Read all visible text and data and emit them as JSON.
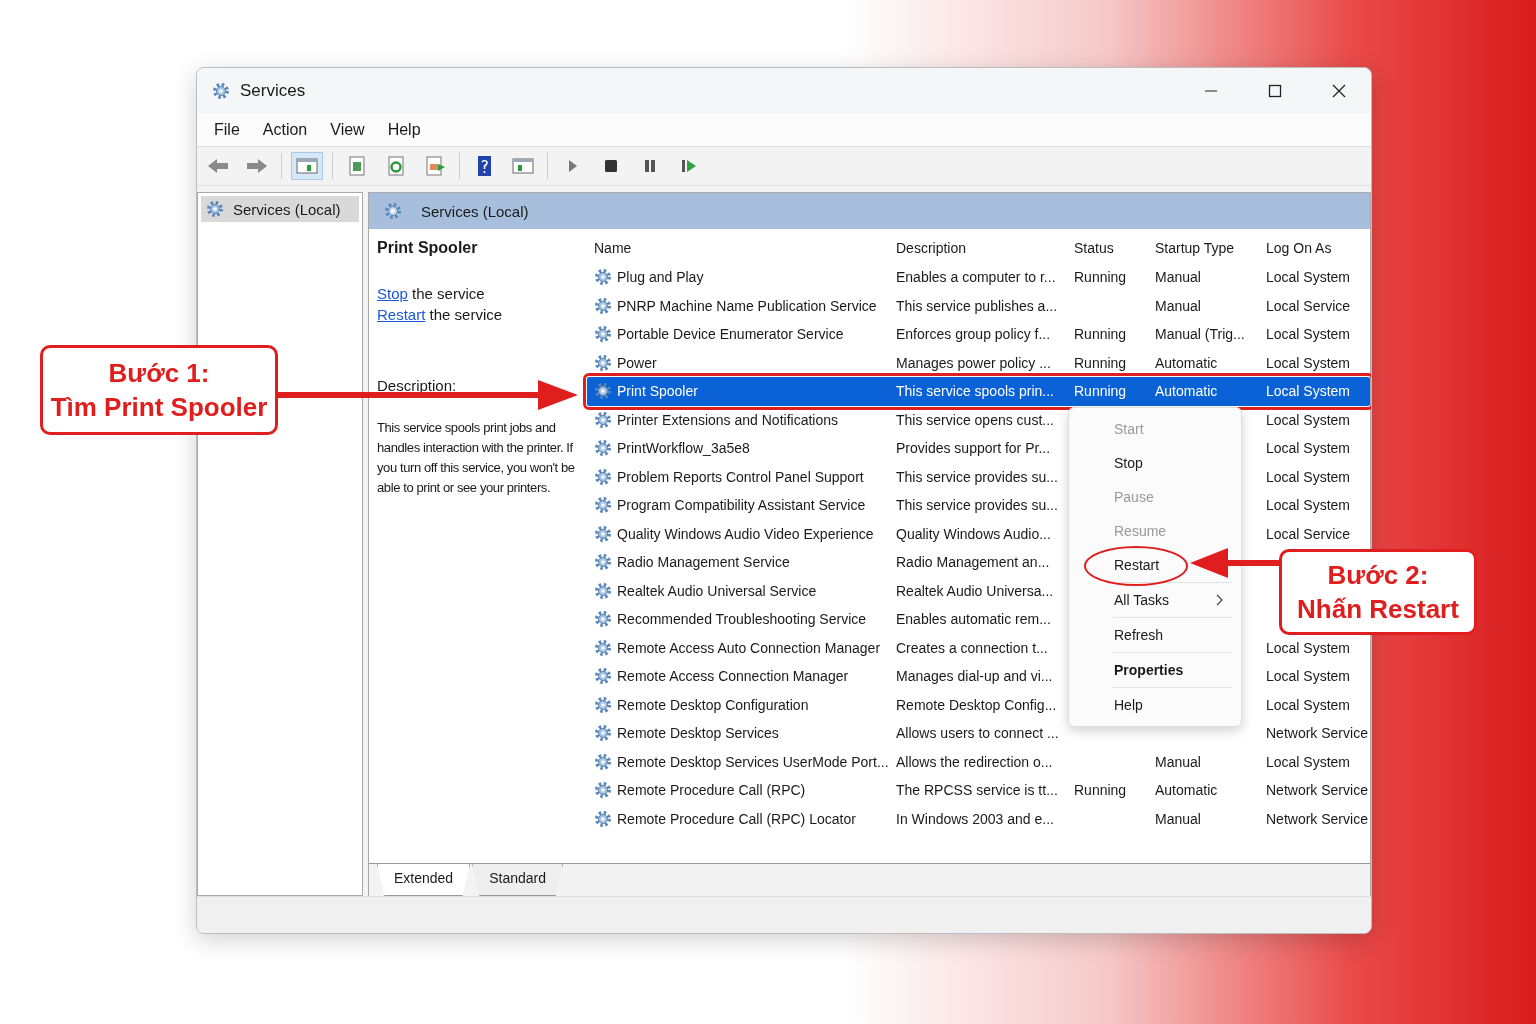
{
  "window": {
    "title": "Services"
  },
  "menu_bar": [
    "File",
    "Action",
    "View",
    "Help"
  ],
  "tree": {
    "items": [
      {
        "label": "Services (Local)",
        "selected": true
      }
    ]
  },
  "pane_header": {
    "title": "Services (Local)"
  },
  "details": {
    "title": "Print Spooler",
    "actions": [
      {
        "link": "Stop",
        "text": "the service"
      },
      {
        "link": "Restart",
        "text": "the service"
      }
    ],
    "description_label": "Description:",
    "description": "This service spools print jobs and handles interaction with the printer. If you turn off this service, you won't be able to print or see your printers."
  },
  "table": {
    "columns": [
      "Name",
      "Description",
      "Status",
      "Startup Type",
      "Log On As"
    ],
    "rows": [
      {
        "name": "Plug and Play",
        "description": "Enables a computer to r...",
        "status": "Running",
        "startup": "Manual",
        "log_on": "Local System",
        "selected": false,
        "outlined": false
      },
      {
        "name": "PNRP Machine Name Publication Service",
        "description": "This service publishes a...",
        "startup": "Manual",
        "log_on": "Local Service",
        "selected": false,
        "outlined": false
      },
      {
        "name": "Portable Device Enumerator Service",
        "description": "Enforces group policy f...",
        "status": "Running",
        "startup": "Manual (Trig...",
        "log_on": "Local System",
        "selected": false,
        "outlined": false
      },
      {
        "name": "Power",
        "description": "Manages power policy ...",
        "status": "Running",
        "startup": "Automatic",
        "log_on": "Local System",
        "selected": false,
        "outlined": false
      },
      {
        "name": "Print Spooler",
        "description": "This service spools prin...",
        "status": "Running",
        "startup": "Automatic",
        "log_on": "Local System",
        "selected": true,
        "outlined": true
      },
      {
        "name": "Printer Extensions and Notifications",
        "description": "This service opens cust...",
        "log_on": "Local System",
        "selected": false,
        "outlined": false
      },
      {
        "name": "PrintWorkflow_3a5e8",
        "description": "Provides support for Pr...",
        "log_on": "Local System",
        "selected": false,
        "outlined": false
      },
      {
        "name": "Problem Reports Control Panel Support",
        "description": "This service provides su...",
        "log_on": "Local System",
        "selected": false,
        "outlined": false
      },
      {
        "name": "Program Compatibility Assistant Service",
        "description": "This service provides su...",
        "log_on": "Local System",
        "selected": false,
        "outlined": false
      },
      {
        "name": "Quality Windows Audio Video Experience",
        "description": "Quality Windows Audio...",
        "log_on": "Local Service",
        "selected": false,
        "outlined": false
      },
      {
        "name": "Radio Management Service",
        "description": "Radio Management an...",
        "selected": false,
        "outlined": false
      },
      {
        "name": "Realtek Audio Universal Service",
        "description": "Realtek Audio Universa...",
        "selected": false,
        "outlined": false
      },
      {
        "name": "Recommended Troubleshooting Service",
        "description": "Enables automatic rem...",
        "selected": false,
        "outlined": false
      },
      {
        "name": "Remote Access Auto Connection Manager",
        "description": "Creates a connection t...",
        "log_on": "Local System",
        "selected": false,
        "outlined": false
      },
      {
        "name": "Remote Access Connection Manager",
        "description": "Manages dial-up and vi...",
        "log_on": "Local System",
        "selected": false,
        "outlined": false
      },
      {
        "name": "Remote Desktop Configuration",
        "description": "Remote Desktop Config...",
        "log_on": "Local System",
        "selected": false,
        "outlined": false
      },
      {
        "name": "Remote Desktop Services",
        "description": "Allows users to connect ...",
        "log_on": "Network Service",
        "selected": false,
        "outlined": false
      },
      {
        "name": "Remote Desktop Services UserMode Port...",
        "description": "Allows the redirection o...",
        "startup": "Manual",
        "log_on": "Local System",
        "selected": false,
        "outlined": false
      },
      {
        "name": "Remote Procedure Call (RPC)",
        "description": "The RPCSS service is tt...",
        "status": "Running",
        "startup": "Automatic",
        "log_on": "Network Service",
        "selected": false,
        "outlined": false
      },
      {
        "name": "Remote Procedure Call (RPC) Locator",
        "description": "In Windows 2003 and e...",
        "startup": "Manual",
        "log_on": "Network Service",
        "selected": false,
        "outlined": false
      }
    ]
  },
  "bottom_tabs": [
    {
      "label": "Extended",
      "selected": true
    },
    {
      "label": "Standard",
      "selected": false
    }
  ],
  "context_menu": {
    "groups": [
      {
        "items": [
          {
            "label": "Start",
            "disabled": true,
            "default": false,
            "submenu": false,
            "circled": false
          },
          {
            "label": "Stop",
            "disabled": false,
            "default": false,
            "submenu": false,
            "circled": false
          },
          {
            "label": "Pause",
            "disabled": true,
            "default": false,
            "submenu": false,
            "circled": false
          },
          {
            "label": "Resume",
            "disabled": true,
            "default": false,
            "submenu": false,
            "circled": false
          },
          {
            "label": "Restart",
            "disabled": false,
            "default": false,
            "submenu": false,
            "circled": true
          }
        ]
      },
      {
        "items": [
          {
            "label": "All Tasks",
            "disabled": false,
            "default": false,
            "submenu": true,
            "circled": false
          }
        ]
      },
      {
        "items": [
          {
            "label": "Refresh",
            "disabled": false,
            "default": false,
            "submenu": false,
            "circled": false
          }
        ]
      },
      {
        "items": [
          {
            "label": "Properties",
            "disabled": false,
            "default": true,
            "submenu": false,
            "circled": false
          }
        ]
      },
      {
        "items": [
          {
            "label": "Help",
            "disabled": false,
            "default": false,
            "submenu": false,
            "circled": false
          }
        ]
      }
    ]
  },
  "callouts": [
    {
      "title": "Bước 1:",
      "text": "Tìm Print Spooler"
    },
    {
      "title": "Bước 2:",
      "text": "Nhấn Restart"
    }
  ]
}
